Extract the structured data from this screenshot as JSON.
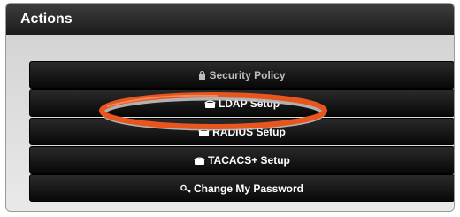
{
  "panel": {
    "title": "Actions"
  },
  "actions": [
    {
      "label": "Security Policy",
      "icon": "lock-icon"
    },
    {
      "label": "LDAP Setup",
      "icon": "phone-icon"
    },
    {
      "label": "RADIUS Setup",
      "icon": "phone-icon"
    },
    {
      "label": "TACACS+ Setup",
      "icon": "phone-icon"
    },
    {
      "label": "Change My Password",
      "icon": "key-icon"
    }
  ],
  "colors": {
    "header": "#2b2b2b",
    "button": "#111111",
    "highlight_ring": "#e8561e"
  }
}
